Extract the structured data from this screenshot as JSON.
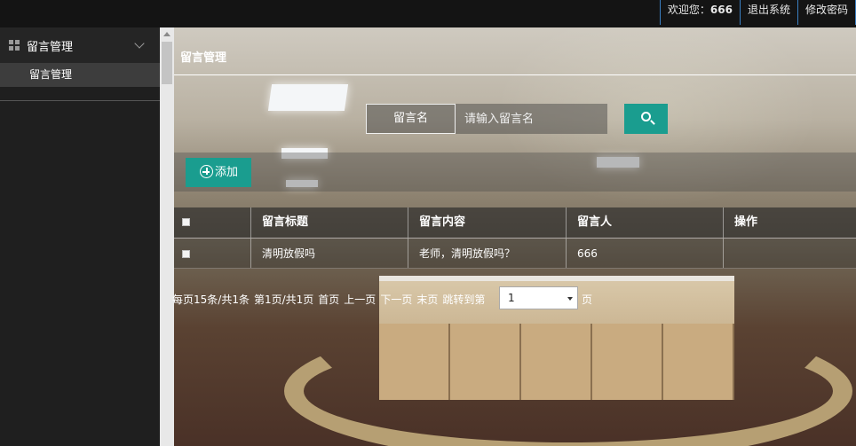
{
  "topbar": {
    "welcome_prefix": "欢迎您：",
    "username": "666",
    "logout": "退出系统",
    "change_password": "修改密码"
  },
  "sidebar": {
    "group_label": "留言管理",
    "items": [
      {
        "label": "留言管理"
      }
    ]
  },
  "main": {
    "page_title": "留言管理",
    "search": {
      "label": "留言名",
      "placeholder": "请输入留言名"
    },
    "add_label": "添加",
    "table": {
      "columns": [
        "留言标题",
        "留言内容",
        "留言人",
        "操作"
      ],
      "rows": [
        {
          "title": "清明放假吗",
          "content": "老师，清明放假吗？",
          "author": "666",
          "action": ""
        }
      ]
    },
    "pagination": {
      "per_page_text": "每页15条/共1条",
      "page_info": "第1页/共1页",
      "first": "首页",
      "prev": "上一页",
      "next": "下一页",
      "last": "末页",
      "jump_to": "跳转到第",
      "selected_page": "1",
      "suffix": "页"
    }
  },
  "colors": {
    "accent": "#1a9d8f",
    "topbar_bg": "#141414",
    "sidebar_bg": "#1f1f1f",
    "topbar_divider": "#3a7fc2"
  }
}
